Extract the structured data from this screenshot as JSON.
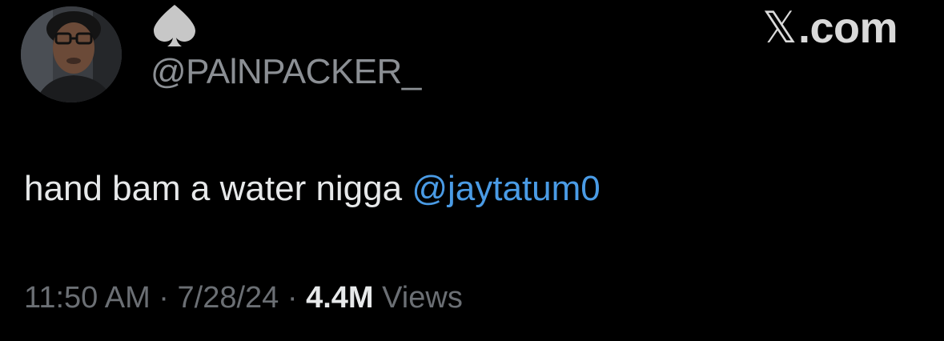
{
  "header": {
    "handle": "@PAlNPACKER_",
    "display_name_icon": "spade-icon",
    "brand_mark": "𝕏",
    "brand_label": ".com",
    "avatar_icon": "profile-avatar"
  },
  "tweet": {
    "text": "hand bam a water nigga",
    "mention": "@jaytatum0"
  },
  "meta": {
    "time": "11:50 AM",
    "separator_1": "·",
    "date": "7/28/24",
    "separator_2": "·",
    "views_count": "4.4M",
    "views_label": "Views"
  },
  "colors": {
    "background": "#000000",
    "text": "#e7e9ea",
    "muted": "#6b6f74",
    "handle": "#8b8f94",
    "link": "#4a9be5"
  }
}
